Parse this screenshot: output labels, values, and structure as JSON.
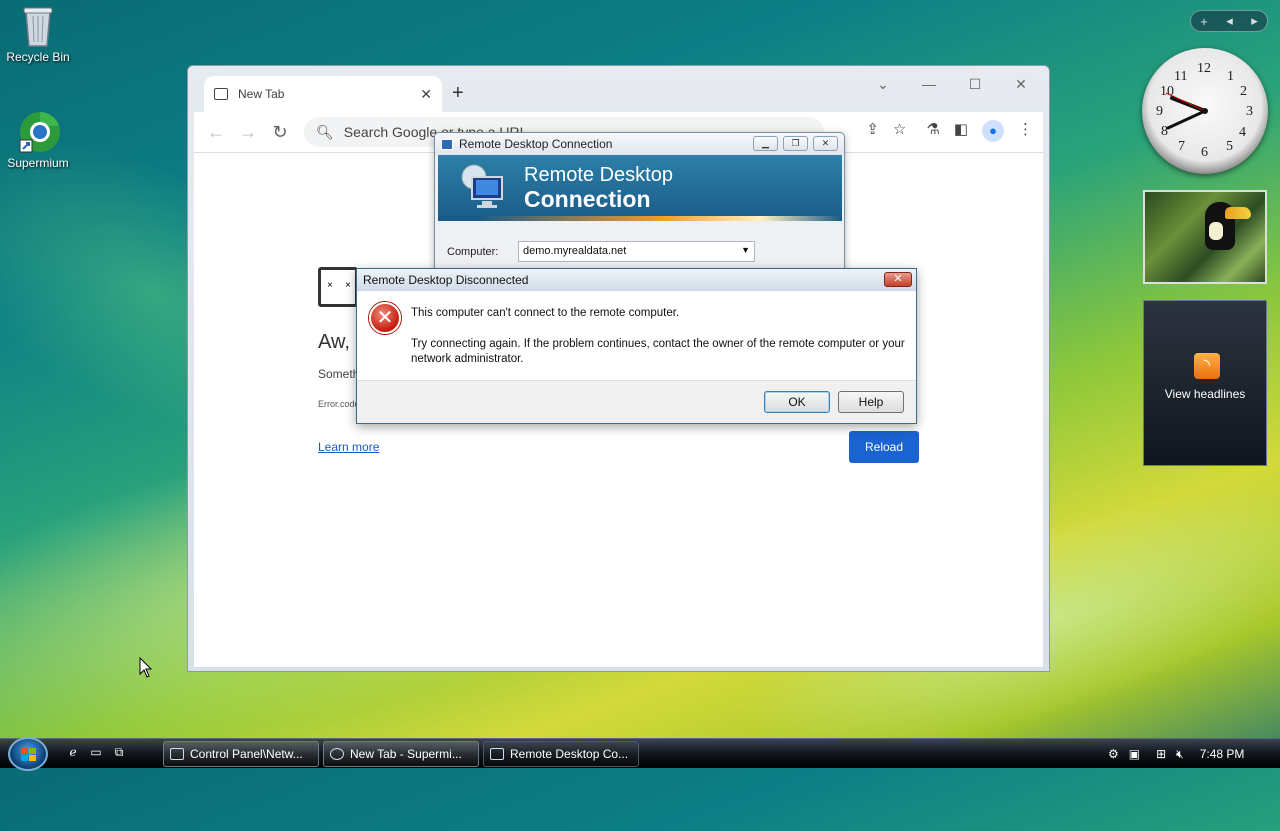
{
  "desktop": {
    "icons": [
      {
        "label": "Recycle Bin"
      },
      {
        "label": "Supermium"
      }
    ]
  },
  "browser": {
    "tab_title": "New Tab",
    "omnibox_placeholder": "Search Google or type a URL",
    "page": {
      "heading": "Aw,",
      "subtext": "Someth",
      "error_code": "Error.code",
      "learn_more": "Learn more",
      "reload": "Reload"
    }
  },
  "rdc": {
    "title": "Remote Desktop Connection",
    "banner_line1": "Remote Desktop",
    "banner_line2": "Connection",
    "computer_label": "Computer:",
    "computer_value": "demo.myrealdata.net"
  },
  "dialog": {
    "title": "Remote Desktop Disconnected",
    "message1": "This computer can't connect to the remote computer.",
    "message2": "Try connecting again. If the problem continues, contact the owner of the remote computer or your network administrator.",
    "ok": "OK",
    "help": "Help"
  },
  "gadgets": {
    "feed_label": "View headlines",
    "clock_numbers": [
      "12",
      "1",
      "2",
      "3",
      "4",
      "5",
      "6",
      "7",
      "8",
      "9",
      "10",
      "11"
    ]
  },
  "taskbar": {
    "tasks": [
      {
        "label": "Control Panel\\Netw..."
      },
      {
        "label": "New Tab - Supermi..."
      },
      {
        "label": "Remote Desktop Co..."
      }
    ],
    "time": "7:48 PM"
  },
  "colors": {
    "reload_button": "#1a63d0",
    "error_icon": "#c41b0d",
    "rss": "#ec6e0c"
  }
}
